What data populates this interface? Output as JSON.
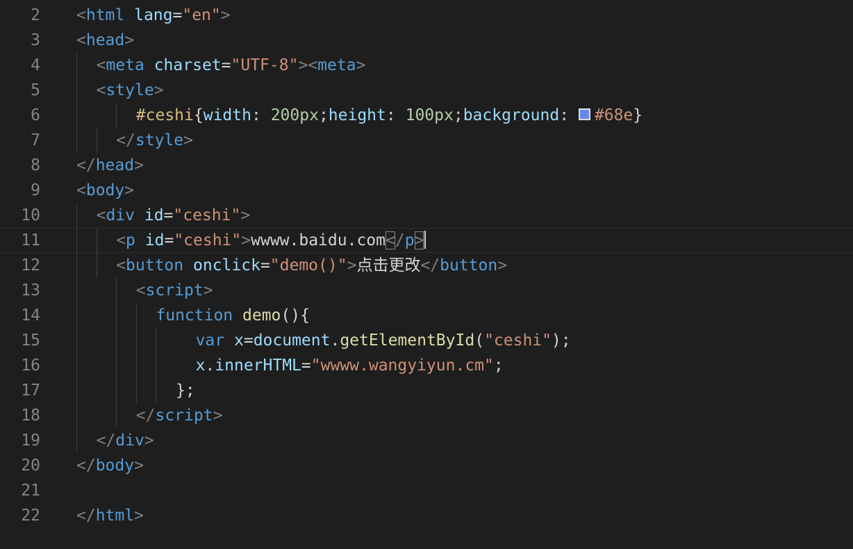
{
  "editor": {
    "lines": [
      {
        "no": "2",
        "indent": 0,
        "guides": [],
        "current": false,
        "tokens": [
          {
            "t": "punct",
            "v": "<"
          },
          {
            "t": "tag",
            "v": "html"
          },
          {
            "t": "text",
            "v": " "
          },
          {
            "t": "attr",
            "v": "lang"
          },
          {
            "t": "text",
            "v": "="
          },
          {
            "t": "str",
            "v": "\"en\""
          },
          {
            "t": "punct",
            "v": ">"
          }
        ]
      },
      {
        "no": "3",
        "indent": 0,
        "guides": [],
        "current": false,
        "tokens": [
          {
            "t": "punct",
            "v": "<"
          },
          {
            "t": "tag",
            "v": "head"
          },
          {
            "t": "punct",
            "v": ">"
          }
        ]
      },
      {
        "no": "4",
        "indent": 1,
        "guides": [
          0
        ],
        "current": false,
        "tokens": [
          {
            "t": "punct",
            "v": "<"
          },
          {
            "t": "tag",
            "v": "meta"
          },
          {
            "t": "text",
            "v": " "
          },
          {
            "t": "attr",
            "v": "charset"
          },
          {
            "t": "text",
            "v": "="
          },
          {
            "t": "str",
            "v": "\"UTF-8\""
          },
          {
            "t": "punct",
            "v": "><"
          },
          {
            "t": "tag",
            "v": "meta"
          },
          {
            "t": "punct",
            "v": ">"
          }
        ]
      },
      {
        "no": "5",
        "indent": 1,
        "guides": [
          0
        ],
        "current": false,
        "tokens": [
          {
            "t": "punct",
            "v": "<"
          },
          {
            "t": "tag",
            "v": "style"
          },
          {
            "t": "punct",
            "v": ">"
          }
        ]
      },
      {
        "no": "6",
        "indent": 3,
        "guides": [
          0,
          2
        ],
        "current": false,
        "tokens": [
          {
            "t": "sel",
            "v": "#ceshi"
          },
          {
            "t": "brace",
            "v": "{"
          },
          {
            "t": "prop",
            "v": "width"
          },
          {
            "t": "text",
            "v": ": "
          },
          {
            "t": "num",
            "v": "200px"
          },
          {
            "t": "text",
            "v": ";"
          },
          {
            "t": "prop",
            "v": "height"
          },
          {
            "t": "text",
            "v": ": "
          },
          {
            "t": "num",
            "v": "100px"
          },
          {
            "t": "text",
            "v": ";"
          },
          {
            "t": "prop",
            "v": "background"
          },
          {
            "t": "text",
            "v": ": "
          },
          {
            "t": "swatch",
            "v": ""
          },
          {
            "t": "hex",
            "v": "#68e"
          },
          {
            "t": "brace",
            "v": "}"
          }
        ]
      },
      {
        "no": "7",
        "indent": 2,
        "guides": [
          0,
          1
        ],
        "current": false,
        "tokens": [
          {
            "t": "punct",
            "v": "</"
          },
          {
            "t": "tag",
            "v": "style"
          },
          {
            "t": "punct",
            "v": ">"
          }
        ]
      },
      {
        "no": "8",
        "indent": 0,
        "guides": [],
        "current": false,
        "tokens": [
          {
            "t": "punct",
            "v": "</"
          },
          {
            "t": "tag",
            "v": "head"
          },
          {
            "t": "punct",
            "v": ">"
          }
        ]
      },
      {
        "no": "9",
        "indent": 0,
        "guides": [],
        "current": false,
        "tokens": [
          {
            "t": "punct",
            "v": "<"
          },
          {
            "t": "tag",
            "v": "body"
          },
          {
            "t": "punct",
            "v": ">"
          }
        ]
      },
      {
        "no": "10",
        "indent": 1,
        "guides": [
          0
        ],
        "current": false,
        "tokens": [
          {
            "t": "punct",
            "v": "<"
          },
          {
            "t": "tag",
            "v": "div"
          },
          {
            "t": "text",
            "v": " "
          },
          {
            "t": "attr",
            "v": "id"
          },
          {
            "t": "text",
            "v": "="
          },
          {
            "t": "str",
            "v": "\"ceshi\""
          },
          {
            "t": "punct",
            "v": ">"
          }
        ]
      },
      {
        "no": "11",
        "indent": 2,
        "guides": [
          0,
          1
        ],
        "current": true,
        "tokens": [
          {
            "t": "punct",
            "v": "<"
          },
          {
            "t": "tag",
            "v": "p"
          },
          {
            "t": "text",
            "v": " "
          },
          {
            "t": "attr",
            "v": "id"
          },
          {
            "t": "text",
            "v": "="
          },
          {
            "t": "str",
            "v": "\"ceshi\""
          },
          {
            "t": "punct",
            "v": ">"
          },
          {
            "t": "text",
            "v": "wwww.baidu.com"
          },
          {
            "t": "punct-match",
            "v": "<"
          },
          {
            "t": "punct",
            "v": "/"
          },
          {
            "t": "tag",
            "v": "p"
          },
          {
            "t": "punct-match",
            "v": ">"
          },
          {
            "t": "cursor",
            "v": ""
          }
        ]
      },
      {
        "no": "12",
        "indent": 2,
        "guides": [
          0,
          1
        ],
        "current": false,
        "tokens": [
          {
            "t": "punct",
            "v": "<"
          },
          {
            "t": "tag",
            "v": "button"
          },
          {
            "t": "text",
            "v": " "
          },
          {
            "t": "attr",
            "v": "onclick"
          },
          {
            "t": "text",
            "v": "="
          },
          {
            "t": "str",
            "v": "\"demo()\""
          },
          {
            "t": "punct",
            "v": ">"
          },
          {
            "t": "text",
            "v": "点击更改"
          },
          {
            "t": "punct",
            "v": "</"
          },
          {
            "t": "tag",
            "v": "button"
          },
          {
            "t": "punct",
            "v": ">"
          }
        ]
      },
      {
        "no": "13",
        "indent": 3,
        "guides": [
          0,
          2
        ],
        "current": false,
        "tokens": [
          {
            "t": "punct",
            "v": "<"
          },
          {
            "t": "tag",
            "v": "script"
          },
          {
            "t": "punct",
            "v": ">"
          }
        ]
      },
      {
        "no": "14",
        "indent": 4,
        "guides": [
          0,
          2,
          3
        ],
        "current": false,
        "tokens": [
          {
            "t": "kw",
            "v": "function"
          },
          {
            "t": "text",
            "v": " "
          },
          {
            "t": "fn",
            "v": "demo"
          },
          {
            "t": "text",
            "v": "(){"
          }
        ]
      },
      {
        "no": "15",
        "indent": 6,
        "guides": [
          0,
          2,
          3,
          4
        ],
        "current": false,
        "tokens": [
          {
            "t": "kw",
            "v": "var"
          },
          {
            "t": "text",
            "v": " "
          },
          {
            "t": "var",
            "v": "x"
          },
          {
            "t": "text",
            "v": "="
          },
          {
            "t": "var",
            "v": "document"
          },
          {
            "t": "text",
            "v": "."
          },
          {
            "t": "fn",
            "v": "getElementById"
          },
          {
            "t": "text",
            "v": "("
          },
          {
            "t": "str",
            "v": "\"ceshi\""
          },
          {
            "t": "text",
            "v": ");"
          }
        ]
      },
      {
        "no": "16",
        "indent": 6,
        "guides": [
          0,
          2,
          3,
          4
        ],
        "current": false,
        "tokens": [
          {
            "t": "var",
            "v": "x"
          },
          {
            "t": "text",
            "v": "."
          },
          {
            "t": "var",
            "v": "innerHTML"
          },
          {
            "t": "text",
            "v": "="
          },
          {
            "t": "str",
            "v": "\"wwww.wangyiyun.cm\""
          },
          {
            "t": "text",
            "v": ";"
          }
        ]
      },
      {
        "no": "17",
        "indent": 5,
        "guides": [
          0,
          2,
          3,
          4
        ],
        "current": false,
        "tokens": [
          {
            "t": "text",
            "v": "};"
          }
        ]
      },
      {
        "no": "18",
        "indent": 3,
        "guides": [
          0,
          2
        ],
        "current": false,
        "tokens": [
          {
            "t": "punct",
            "v": "</"
          },
          {
            "t": "tag",
            "v": "script"
          },
          {
            "t": "punct",
            "v": ">"
          }
        ]
      },
      {
        "no": "19",
        "indent": 1,
        "guides": [
          0
        ],
        "current": false,
        "tokens": [
          {
            "t": "punct",
            "v": "</"
          },
          {
            "t": "tag",
            "v": "div"
          },
          {
            "t": "punct",
            "v": ">"
          }
        ]
      },
      {
        "no": "20",
        "indent": 0,
        "guides": [],
        "current": false,
        "tokens": [
          {
            "t": "punct",
            "v": "</"
          },
          {
            "t": "tag",
            "v": "body"
          },
          {
            "t": "punct",
            "v": ">"
          }
        ]
      },
      {
        "no": "21",
        "indent": 0,
        "guides": [],
        "current": false,
        "tokens": []
      },
      {
        "no": "22",
        "indent": 0,
        "guides": [],
        "current": false,
        "tokens": [
          {
            "t": "punct",
            "v": "</"
          },
          {
            "t": "tag",
            "v": "html"
          },
          {
            "t": "punct",
            "v": ">"
          }
        ]
      }
    ]
  },
  "colors": {
    "background": "#1e1e1e",
    "line_number": "#858585",
    "tag": "#569cd6",
    "attribute": "#9cdcfe",
    "string": "#ce9178",
    "swatch_color": "#6688ee"
  }
}
